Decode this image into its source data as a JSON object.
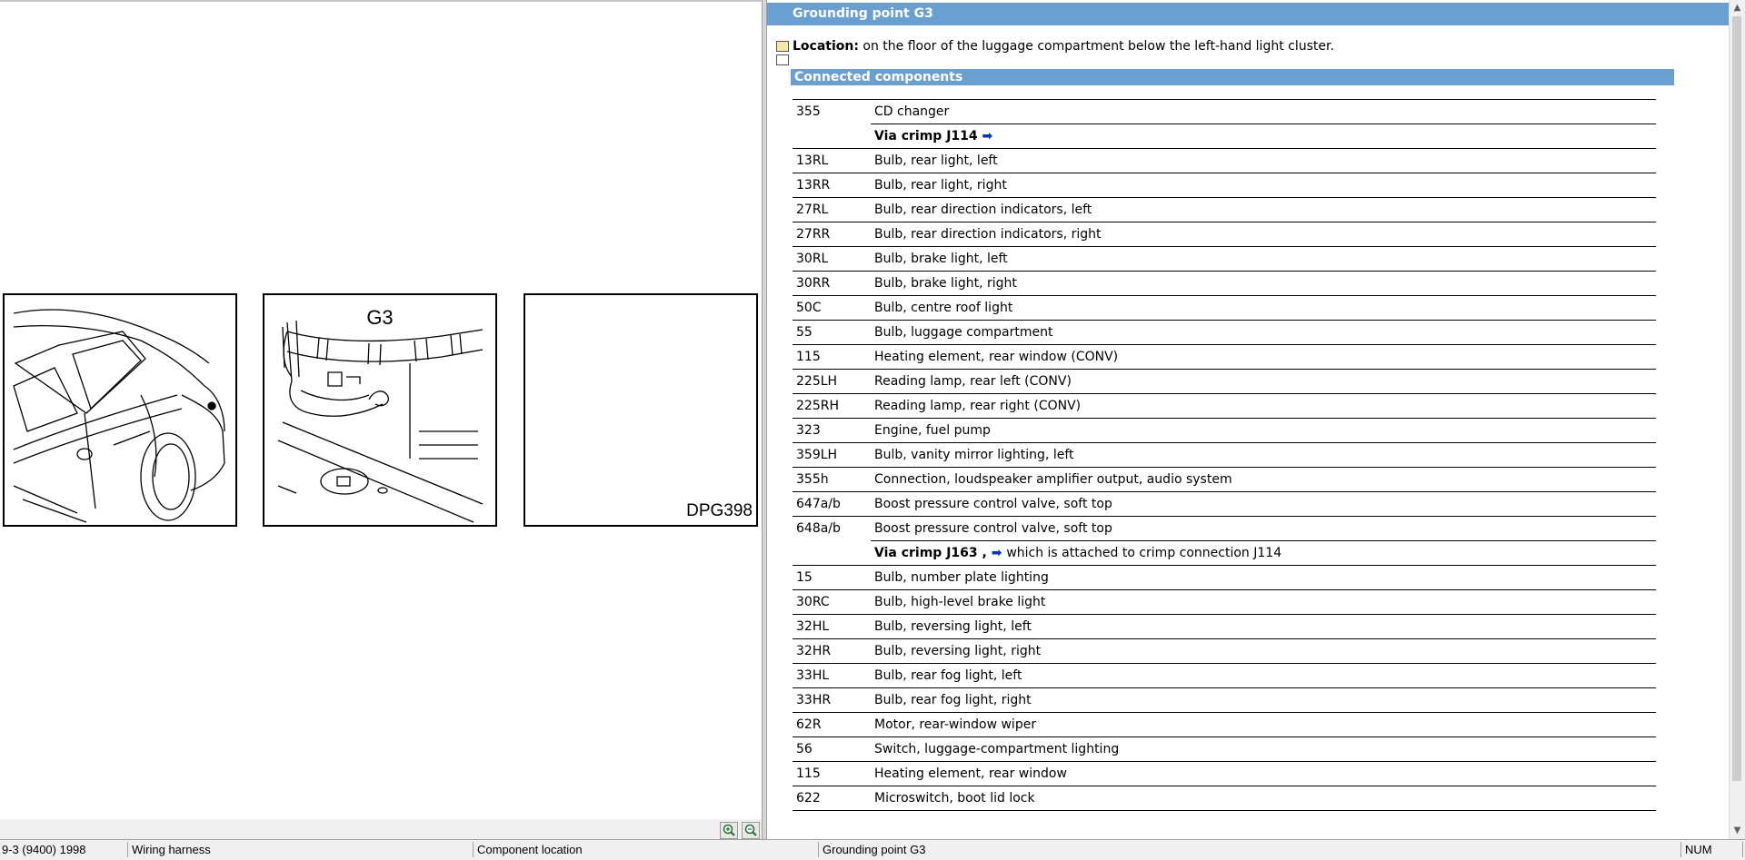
{
  "drawing": {
    "panel2_label": "G3",
    "panel3_label": "DPG398"
  },
  "document": {
    "title": "Grounding point G3",
    "location_label": "Location:",
    "location_text": "on the floor of the luggage compartment below the left-hand light cluster.",
    "section_title": "Connected components",
    "rows": [
      {
        "type": "item",
        "code": "355",
        "desc": "CD changer"
      },
      {
        "type": "via",
        "code": "",
        "desc": "Via crimp J114",
        "arrow": "➡",
        "note": ""
      },
      {
        "type": "item",
        "code": "13RL",
        "desc": "Bulb, rear light, left"
      },
      {
        "type": "item",
        "code": "13RR",
        "desc": "Bulb, rear light, right"
      },
      {
        "type": "item",
        "code": "27RL",
        "desc": "Bulb, rear direction indicators, left"
      },
      {
        "type": "item",
        "code": "27RR",
        "desc": "Bulb, rear direction indicators, right"
      },
      {
        "type": "item",
        "code": "30RL",
        "desc": "Bulb, brake light, left"
      },
      {
        "type": "item",
        "code": "30RR",
        "desc": "Bulb, brake light, right"
      },
      {
        "type": "item",
        "code": "50C",
        "desc": "Bulb, centre roof light"
      },
      {
        "type": "item",
        "code": "55",
        "desc": "Bulb, luggage compartment"
      },
      {
        "type": "item",
        "code": "115",
        "desc": "Heating element, rear window (CONV)"
      },
      {
        "type": "item",
        "code": "225LH",
        "desc": "Reading lamp, rear left (CONV)"
      },
      {
        "type": "item",
        "code": "225RH",
        "desc": "Reading lamp, rear right (CONV)"
      },
      {
        "type": "item",
        "code": "323",
        "desc": "Engine, fuel pump"
      },
      {
        "type": "item",
        "code": "359LH",
        "desc": "Bulb, vanity mirror lighting, left"
      },
      {
        "type": "item",
        "code": "355h",
        "desc": "Connection, loudspeaker amplifier output, audio system"
      },
      {
        "type": "item",
        "code": "647a/b",
        "desc": "Boost pressure control valve, soft top"
      },
      {
        "type": "item",
        "code": "648a/b",
        "desc": "Boost pressure control valve, soft top"
      },
      {
        "type": "via",
        "code": "",
        "desc": "Via crimp J163 ,",
        "arrow": "➡",
        "note": "which is attached to crimp connection J114"
      },
      {
        "type": "item",
        "code": "15",
        "desc": "Bulb, number plate lighting"
      },
      {
        "type": "item",
        "code": "30RC",
        "desc": "Bulb, high-level brake light"
      },
      {
        "type": "item",
        "code": "32HL",
        "desc": "Bulb, reversing light, left"
      },
      {
        "type": "item",
        "code": "32HR",
        "desc": "Bulb, reversing light, right"
      },
      {
        "type": "item",
        "code": "33HL",
        "desc": "Bulb, rear fog light, left"
      },
      {
        "type": "item",
        "code": "33HR",
        "desc": "Bulb, rear fog light, right"
      },
      {
        "type": "item",
        "code": "62R",
        "desc": "Motor, rear-window wiper"
      },
      {
        "type": "item",
        "code": "56",
        "desc": "Switch, luggage-compartment lighting"
      },
      {
        "type": "item",
        "code": "115",
        "desc": "Heating element, rear window"
      },
      {
        "type": "item",
        "code": "622",
        "desc": "Microswitch, boot lid lock"
      }
    ]
  },
  "status_bar": {
    "model": "9-3 (9400) 1998",
    "section": "Wiring harness",
    "view": "Component location",
    "item": "Grounding point G3",
    "num": "NUM"
  },
  "icons": {
    "zoom_in": "zoom-in-icon",
    "zoom_out": "zoom-out-icon",
    "scroll_up": "scroll-up-arrow-icon",
    "scroll_down": "scroll-down-arrow-icon"
  },
  "colors": {
    "header_blue": "#6a9fd2",
    "link_arrow": "#0033cc"
  }
}
